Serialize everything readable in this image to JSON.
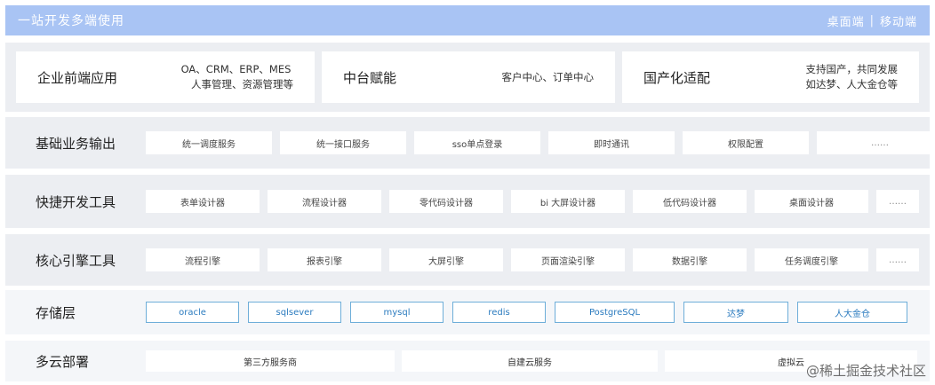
{
  "header": {
    "title": "一站开发多端使用",
    "right_a": "桌面端",
    "separator": "|",
    "right_b": "移动端"
  },
  "apps": [
    {
      "title": "企业前端应用",
      "line1": "OA、CRM、ERP、MES",
      "line2": "人事管理、资源管理等"
    },
    {
      "title": "中台赋能",
      "line1": "客户中心、订单中心",
      "line2": ""
    },
    {
      "title": "国产化适配",
      "line1": "支持国产，共同发展",
      "line2": "如达梦、人大金仓等"
    }
  ],
  "basic": {
    "label": "基础业务输出",
    "items": [
      "统一调度服务",
      "统一接口服务",
      "sso单点登录",
      "即时通讯",
      "权限配置",
      "……"
    ]
  },
  "dev": {
    "label": "快捷开发工具",
    "items": [
      "表单设计器",
      "流程设计器",
      "零代码设计器",
      "bi 大屏设计器",
      "低代码设计器",
      "桌面设计器",
      "……"
    ]
  },
  "engine": {
    "label": "核心引擎工具",
    "items": [
      "流程引擎",
      "报表引擎",
      "大屏引擎",
      "页面渲染引擎",
      "数据引擎",
      "任务调度引擎",
      "……"
    ]
  },
  "storage": {
    "label": "存储层",
    "items": [
      "oracle",
      "sqlsever",
      "mysql",
      "redis",
      "PostgreSQL",
      "达梦",
      "人大金仓"
    ]
  },
  "cloud": {
    "label": "多云部署",
    "items": [
      "第三方服务商",
      "自建云服务",
      "虚拟云"
    ]
  },
  "watermark": "@稀土掘金技术社区",
  "colors": {
    "header": "#a9c4f4",
    "row_bg": "#eceef2",
    "storage_border": "#6eaed9",
    "storage_text": "#2b7bbf"
  }
}
